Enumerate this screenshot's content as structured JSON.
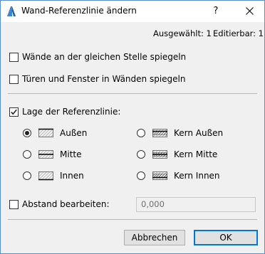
{
  "window": {
    "title": "Wand-Referenzlinie ändern",
    "help_label": "?",
    "close_icon": "close-icon",
    "app_icon": "archicad-icon"
  },
  "info": {
    "selected": "Ausgewählt: 1",
    "editable": "Editierbar: 1"
  },
  "options": {
    "mirror_walls": {
      "label": "Wände an der gleichen Stelle spiegeln",
      "checked": false
    },
    "mirror_openings": {
      "label": "Türen und Fenster in Wänden spiegeln",
      "checked": false
    }
  },
  "reference_line": {
    "label": "Lage der Referenzlinie:",
    "checked": true,
    "choices": [
      {
        "label": "Außen",
        "selected": true,
        "icon": "wall-outside-icon"
      },
      {
        "label": "Mitte",
        "selected": false,
        "icon": "wall-center-icon"
      },
      {
        "label": "Innen",
        "selected": false,
        "icon": "wall-inside-icon"
      },
      {
        "label": "Kern Außen",
        "selected": false,
        "icon": "wall-core-outside-icon"
      },
      {
        "label": "Kern Mitte",
        "selected": false,
        "icon": "wall-core-center-icon"
      },
      {
        "label": "Kern Innen",
        "selected": false,
        "icon": "wall-core-inside-icon"
      }
    ]
  },
  "offset": {
    "label": "Abstand bearbeiten:",
    "checked": false,
    "value": "0,000"
  },
  "buttons": {
    "cancel": "Abbrechen",
    "ok": "OK"
  },
  "colors": {
    "window_border": "#5b8ec7",
    "primary_border": "#0078d7",
    "background": "#f0f0f0"
  }
}
